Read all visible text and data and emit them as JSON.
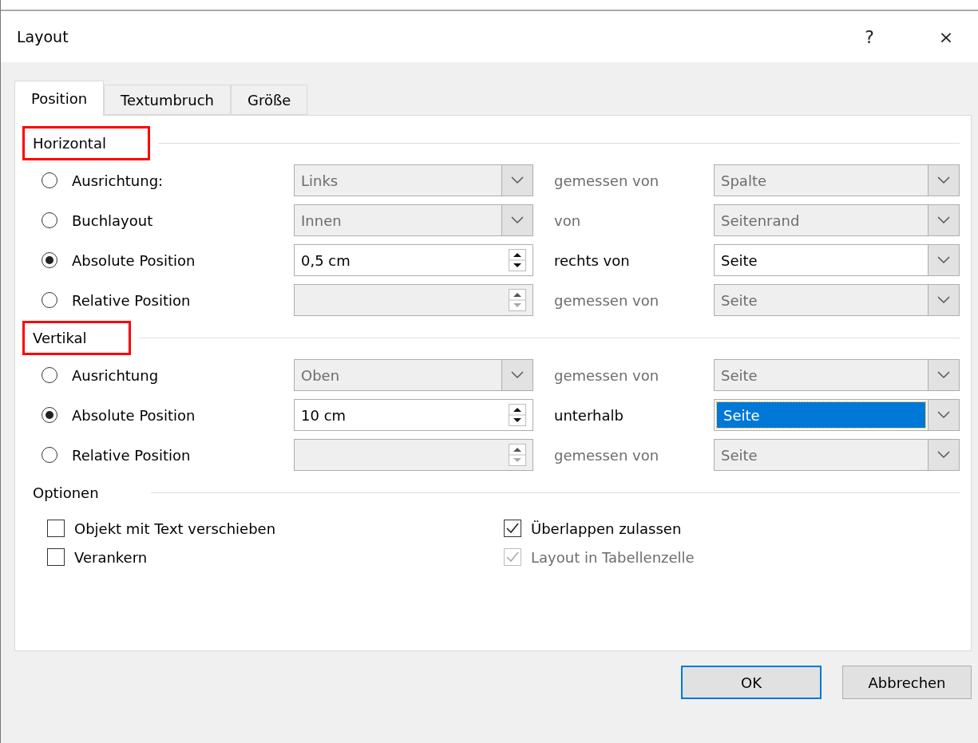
{
  "window": {
    "title": "Layout",
    "help": "?",
    "close": "×"
  },
  "tabs": [
    {
      "label": "Position",
      "selected": true
    },
    {
      "label": "Textumbruch",
      "selected": false
    },
    {
      "label": "Größe",
      "selected": false
    }
  ],
  "sections": [
    {
      "title": "Horizontal",
      "highlighted": true,
      "rows": [
        {
          "label": "Ausrichtung:",
          "selected": false,
          "kind": "dropdown",
          "value": "Links",
          "enabled": false,
          "relation": "gemessen von",
          "relation_value": "Spalte",
          "relation_focused": false
        },
        {
          "label": "Buchlayout",
          "selected": false,
          "kind": "dropdown",
          "value": "Innen",
          "enabled": false,
          "relation": "von",
          "relation_value": "Seitenrand",
          "relation_focused": false
        },
        {
          "label": "Absolute Position",
          "selected": true,
          "kind": "spinner",
          "value": "0,5 cm",
          "enabled": true,
          "relation": "rechts von",
          "relation_value": "Seite",
          "relation_focused": false
        },
        {
          "label": "Relative Position",
          "selected": false,
          "kind": "spinner",
          "enabled": false,
          "relation": "gemessen von",
          "relation_value": "Seite",
          "relation_focused": false
        }
      ]
    },
    {
      "title": "Vertikal",
      "highlighted": true,
      "rows": [
        {
          "label": "Ausrichtung",
          "selected": false,
          "kind": "dropdown",
          "value": "Oben",
          "enabled": false,
          "relation": "gemessen von",
          "relation_value": "Seite",
          "relation_focused": false
        },
        {
          "label": "Absolute Position",
          "selected": true,
          "kind": "spinner",
          "value": "10 cm",
          "enabled": true,
          "relation": "unterhalb",
          "relation_value": "Seite",
          "relation_focused": true
        },
        {
          "label": "Relative Position",
          "selected": false,
          "kind": "spinner",
          "enabled": false,
          "relation": "gemessen von",
          "relation_value": "Seite",
          "relation_focused": false
        }
      ]
    }
  ],
  "options": {
    "title": "Optionen",
    "checkboxes": [
      {
        "label": "Objekt mit Text verschieben",
        "checked": false,
        "disabled": false
      },
      {
        "label": "Überlappen zulassen",
        "checked": true,
        "disabled": false
      },
      {
        "label": "Verankern",
        "checked": false,
        "disabled": false
      },
      {
        "label": "Layout in Tabellenzelle",
        "checked": true,
        "disabled": true
      }
    ]
  },
  "buttons": [
    {
      "label": "OK",
      "default": true
    },
    {
      "label": "Abbrechen",
      "default": false
    }
  ]
}
